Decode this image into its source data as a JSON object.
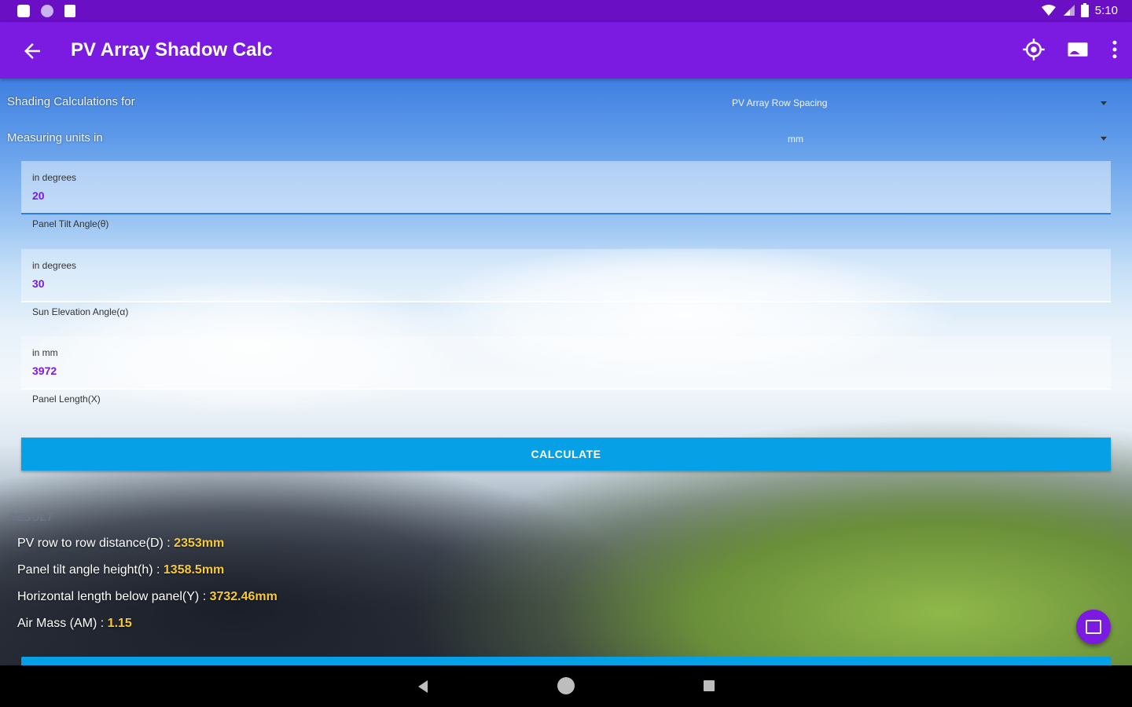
{
  "status_bar": {
    "time": "5:10"
  },
  "app_bar": {
    "title": "PV Array Shadow Calc",
    "icons": [
      "arrow-back-icon",
      "target-location-icon",
      "cast-screen-icon",
      "more-vert-icon"
    ]
  },
  "shading": {
    "label": "Shading Calculations for",
    "selected": "PV Array Row Spacing"
  },
  "units": {
    "label": "Measuring units in",
    "selected": "mm"
  },
  "fields": [
    {
      "hint": "in degrees",
      "value": "20",
      "caption": "Panel Tilt Angle(θ)"
    },
    {
      "hint": "in degrees",
      "value": "30",
      "caption": "Sun Elevation Angle(α)"
    },
    {
      "hint": "in mm",
      "value": "3972",
      "caption": "Panel Length(X)"
    }
  ],
  "calculate_label": "CALCULATE",
  "result": {
    "heading": "RESULT",
    "lines": [
      {
        "label": "PV row to row distance(D) : ",
        "value": "2353mm"
      },
      {
        "label": "Panel tilt angle height(h) : ",
        "value": "1358.5mm"
      },
      {
        "label": "Horizontal length below panel(Y) : ",
        "value": "3732.46mm"
      },
      {
        "label": "Air Mass (AM) : ",
        "value": "1.15"
      }
    ]
  },
  "colors": {
    "status_bar": "#6a0fc4",
    "app_bar": "#7b1ae0",
    "button": "#05a0e6",
    "result_value": "#f6c93b"
  }
}
